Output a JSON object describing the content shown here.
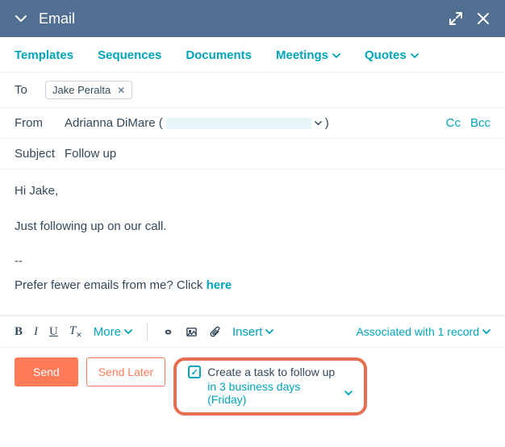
{
  "header": {
    "title": "Email"
  },
  "tabs": {
    "templates": "Templates",
    "sequences": "Sequences",
    "documents": "Documents",
    "meetings": "Meetings",
    "quotes": "Quotes"
  },
  "fields": {
    "to_label": "To",
    "to_chip": "Jake Peralta",
    "from_label": "From",
    "from_name": "Adrianna DiMare (",
    "from_close": ")",
    "cc": "Cc",
    "bcc": "Bcc",
    "subject_label": "Subject",
    "subject_value": "Follow up"
  },
  "body": {
    "greeting": "Hi Jake,",
    "p1": "Just following up on our call.",
    "sep": "--",
    "sig_text": "Prefer fewer emails from me? Click ",
    "sig_link": "here"
  },
  "toolbar": {
    "more": "More",
    "insert": "Insert",
    "associated": "Associated with 1 record"
  },
  "footer": {
    "send": "Send",
    "send_later": "Send Later",
    "task_label": "Create a task to follow up",
    "task_when": "in 3 business days (Friday)"
  }
}
